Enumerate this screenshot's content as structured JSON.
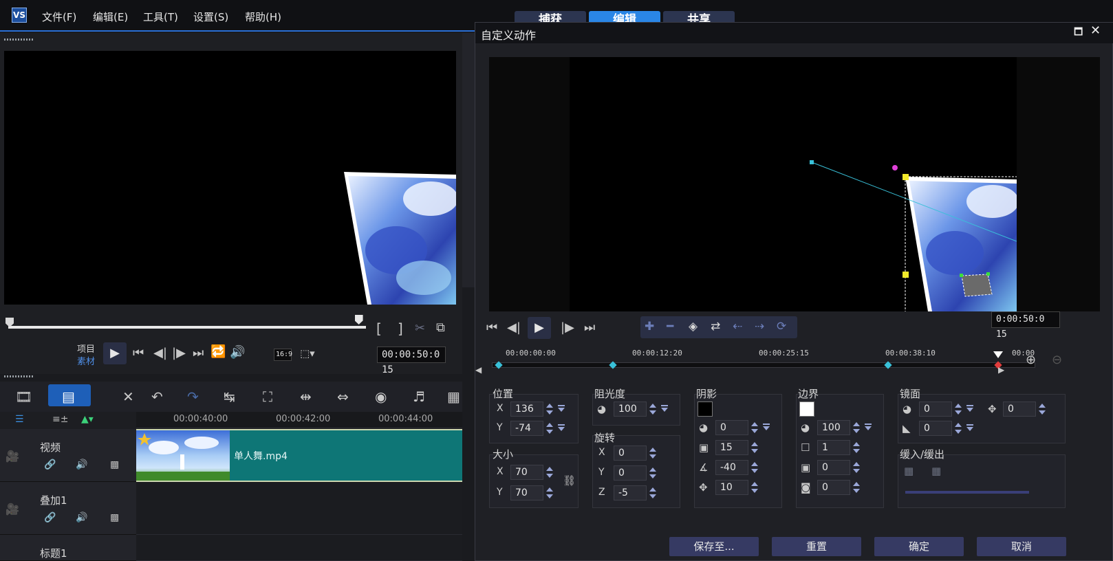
{
  "menubar": {
    "logo": "VS",
    "items": [
      "文件(F)",
      "编辑(E)",
      "工具(T)",
      "设置(S)",
      "帮助(H)"
    ],
    "mode_tabs": [
      "捕获",
      "编辑",
      "共享"
    ]
  },
  "preview": {
    "mode_labels": [
      "项目",
      "素材"
    ],
    "timecode": "00:00:50:0 15",
    "aspect": "16:9",
    "scrub_progress": 0.98
  },
  "timeline": {
    "ruler_labels": [
      "00:00:40:00",
      "00:00:42:00",
      "00:00:44:00"
    ],
    "tracks": [
      {
        "name": "视频"
      },
      {
        "name": "叠加1"
      },
      {
        "name": "标题1"
      }
    ],
    "clip_name": "单人舞.mp4"
  },
  "dialog": {
    "title": "自定义动作",
    "timecode": "0:00:50:0 15",
    "ruler_labels": [
      "00:00:00:00",
      "00:00:12:20",
      "00:00:25:15",
      "00:00:38:10",
      "00:00"
    ],
    "position": {
      "title": "位置",
      "x_label": "X",
      "y_label": "Y",
      "x": "136",
      "y": "-74"
    },
    "size": {
      "title": "大小",
      "x_label": "X",
      "y_label": "Y",
      "x": "70",
      "y": "70"
    },
    "opacity": {
      "title": "阻光度",
      "value": "100"
    },
    "rotation": {
      "title": "旋转",
      "x_label": "X",
      "y_label": "Y",
      "z_label": "Z",
      "x": "0",
      "y": "0",
      "z": "-5"
    },
    "shadow": {
      "title": "阴影",
      "color": "#000000",
      "opacity": "0",
      "blur": "15",
      "angle": "-40",
      "distance": "10"
    },
    "border": {
      "title": "边界",
      "color": "#ffffff",
      "opacity": "100",
      "width": "1",
      "v2": "0",
      "v3": "0"
    },
    "mirror": {
      "title": "镜面",
      "opacity": "0",
      "offset": "0",
      "fade": "0"
    },
    "ease": {
      "title": "缓入/缓出"
    },
    "buttons": {
      "save": "保存至...",
      "reset": "重置",
      "ok": "确定",
      "cancel": "取消"
    }
  },
  "colors": {
    "accent": "#2a86e6",
    "clip": "#0e7676",
    "button": "#363a63"
  }
}
